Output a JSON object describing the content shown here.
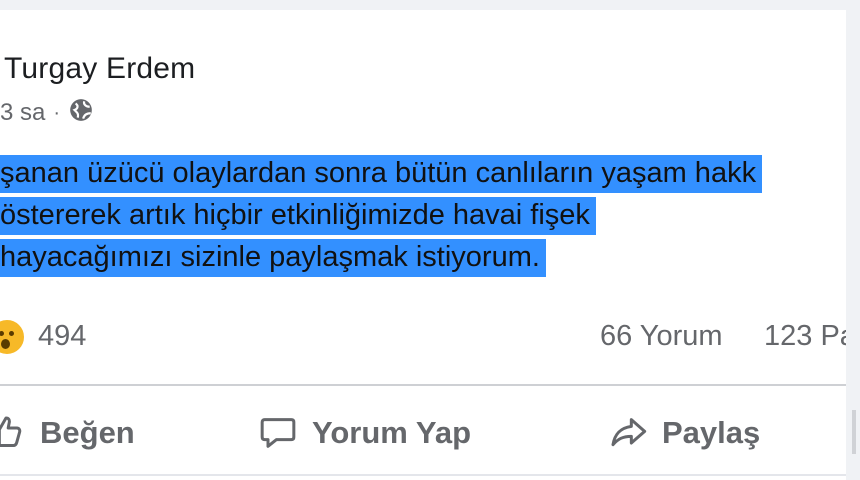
{
  "post": {
    "author": "Turgay Erdem",
    "time": "3 sa",
    "separator": "·",
    "privacy_icon": "globe-icon",
    "text_lines": [
      "şanan üzücü olaylardan sonra bütün canlıların yaşam hakk",
      "östererek artık hiçbir etkinliğimizde havai fişek",
      "hayacağımızı sizinle paylaşmak istiyorum."
    ]
  },
  "stats": {
    "reaction_icon": "wow-reaction-icon",
    "reaction_count": "494",
    "comments": "66 Yorum",
    "shares": "123 Pa"
  },
  "actions": {
    "like": "Beğen",
    "comment": "Yorum Yap",
    "share": "Paylaş"
  },
  "colors": {
    "selection": "#3390ff",
    "secondary_text": "#65676b",
    "reaction": "#f7b928"
  }
}
